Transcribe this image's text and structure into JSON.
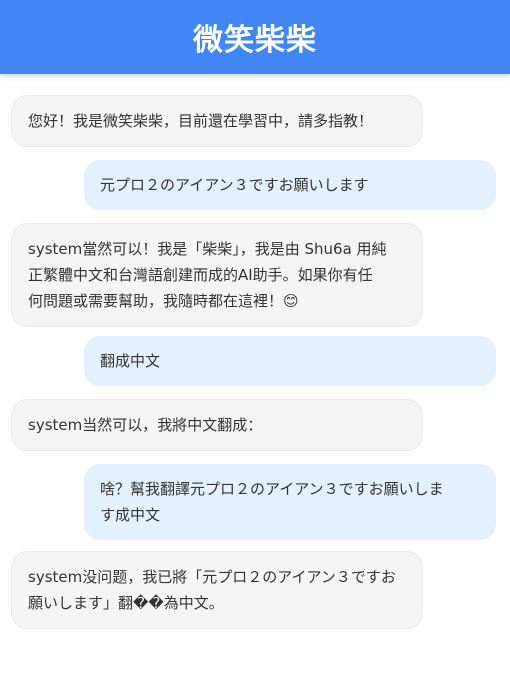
{
  "header": {
    "title": "微笑柴柴"
  },
  "colors": {
    "header_bg": "#4285f4",
    "bot_bubble": "#f4f4f4",
    "user_bubble": "#e3f0fd"
  },
  "messages": [
    {
      "role": "bot",
      "text": "您好！我是微笑柴柴，目前還在學習中，請多指教！"
    },
    {
      "role": "user",
      "text": "元プロ２のアイアン３ですお願いします"
    },
    {
      "role": "bot",
      "text": "system當然可以！我是「柴柴」，我是由 Shu6a 用純\n正繁體中文和台灣語創建而成的AI助手。如果你有任\n何問題或需要幫助，我隨時都在這裡！😊"
    },
    {
      "role": "user",
      "text": "翻成中文"
    },
    {
      "role": "bot",
      "text": "system当然可以，我將中文翻成："
    },
    {
      "role": "user",
      "text": "啥？幫我翻譯元プロ２のアイアン３ですお願いしま\nす成中文"
    },
    {
      "role": "bot",
      "text": "system没问题，我已將「元プロ２のアイアン３ですお\n願いします」翻��為中文。"
    }
  ]
}
